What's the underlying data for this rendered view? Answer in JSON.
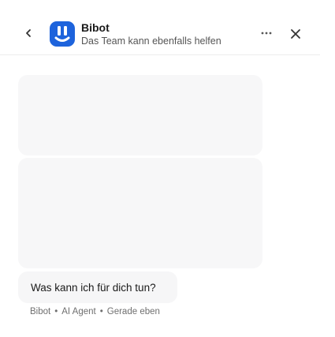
{
  "header": {
    "title": "Bibot",
    "subtitle": "Das Team kann ebenfalls helfen",
    "back_icon": "chevron-left-icon",
    "more_icon": "more-horizontal-icon",
    "close_icon": "close-icon"
  },
  "message": {
    "text": "Was kann ich für dich tun?",
    "sender": "Bibot",
    "role": "AI Agent",
    "time": "Gerade eben"
  },
  "colors": {
    "brand": "#1d63dc",
    "bubble": "#f6f6f7"
  }
}
